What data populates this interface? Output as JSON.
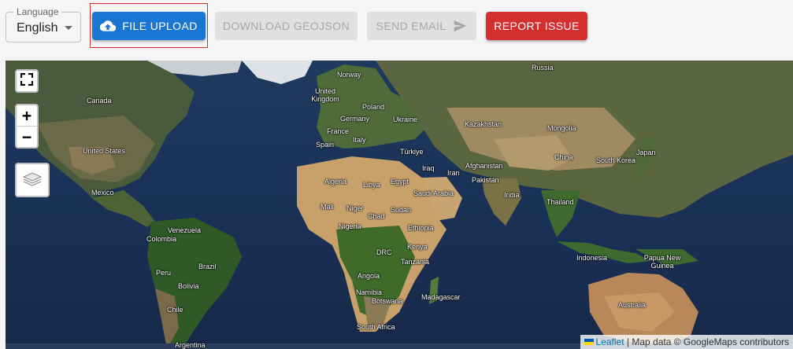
{
  "toolbar": {
    "language": {
      "legend": "Language",
      "value": "English"
    },
    "buttons": {
      "file_upload": "FILE UPLOAD",
      "download_geojson": "DOWNLOAD GEOJSON",
      "send_email": "SEND EMAIL",
      "report_issue": "REPORT ISSUE"
    },
    "colors": {
      "primary": "#1976d2",
      "error": "#d32f2f",
      "disabled_bg": "#e0e0e0",
      "disabled_text": "#a6a6a6"
    },
    "icons": {
      "file_upload": "cloud-upload-icon",
      "send_email": "send-icon",
      "language": "dropdown-arrow-icon"
    }
  },
  "map": {
    "controls": {
      "fullscreen": "fullscreen-icon",
      "zoom_in": "+",
      "zoom_out": "−",
      "layers": "layers-icon"
    },
    "labels": [
      "Russia",
      "Norway",
      "Canada",
      "United Kingdom",
      "Poland",
      "Germany",
      "Ukraine",
      "Kazakhstan",
      "Mongolia",
      "France",
      "Italy",
      "Spain",
      "United States",
      "Türkiye",
      "Iraq",
      "Iran",
      "Afghanistan",
      "China",
      "South Korea",
      "Japan",
      "Pakistan",
      "Algeria",
      "Libya",
      "Egypt",
      "Saudi Arabia",
      "India",
      "Mexico",
      "Mali",
      "Niger",
      "Chad",
      "Sudan",
      "Thailand",
      "Venezuela",
      "Nigeria",
      "Ethiopia",
      "Colombia",
      "Kenya",
      "DRC",
      "Tanzania",
      "Indonesia",
      "Papua New Guinea",
      "Peru",
      "Brazil",
      "Angola",
      "Bolivia",
      "Namibia",
      "Madagascar",
      "Botswana",
      "Australia",
      "Chile",
      "South Africa",
      "Argentina"
    ],
    "attribution": {
      "link": "Leaflet",
      "separator": "|",
      "text": "Map data © GoogleMaps contributors"
    }
  }
}
